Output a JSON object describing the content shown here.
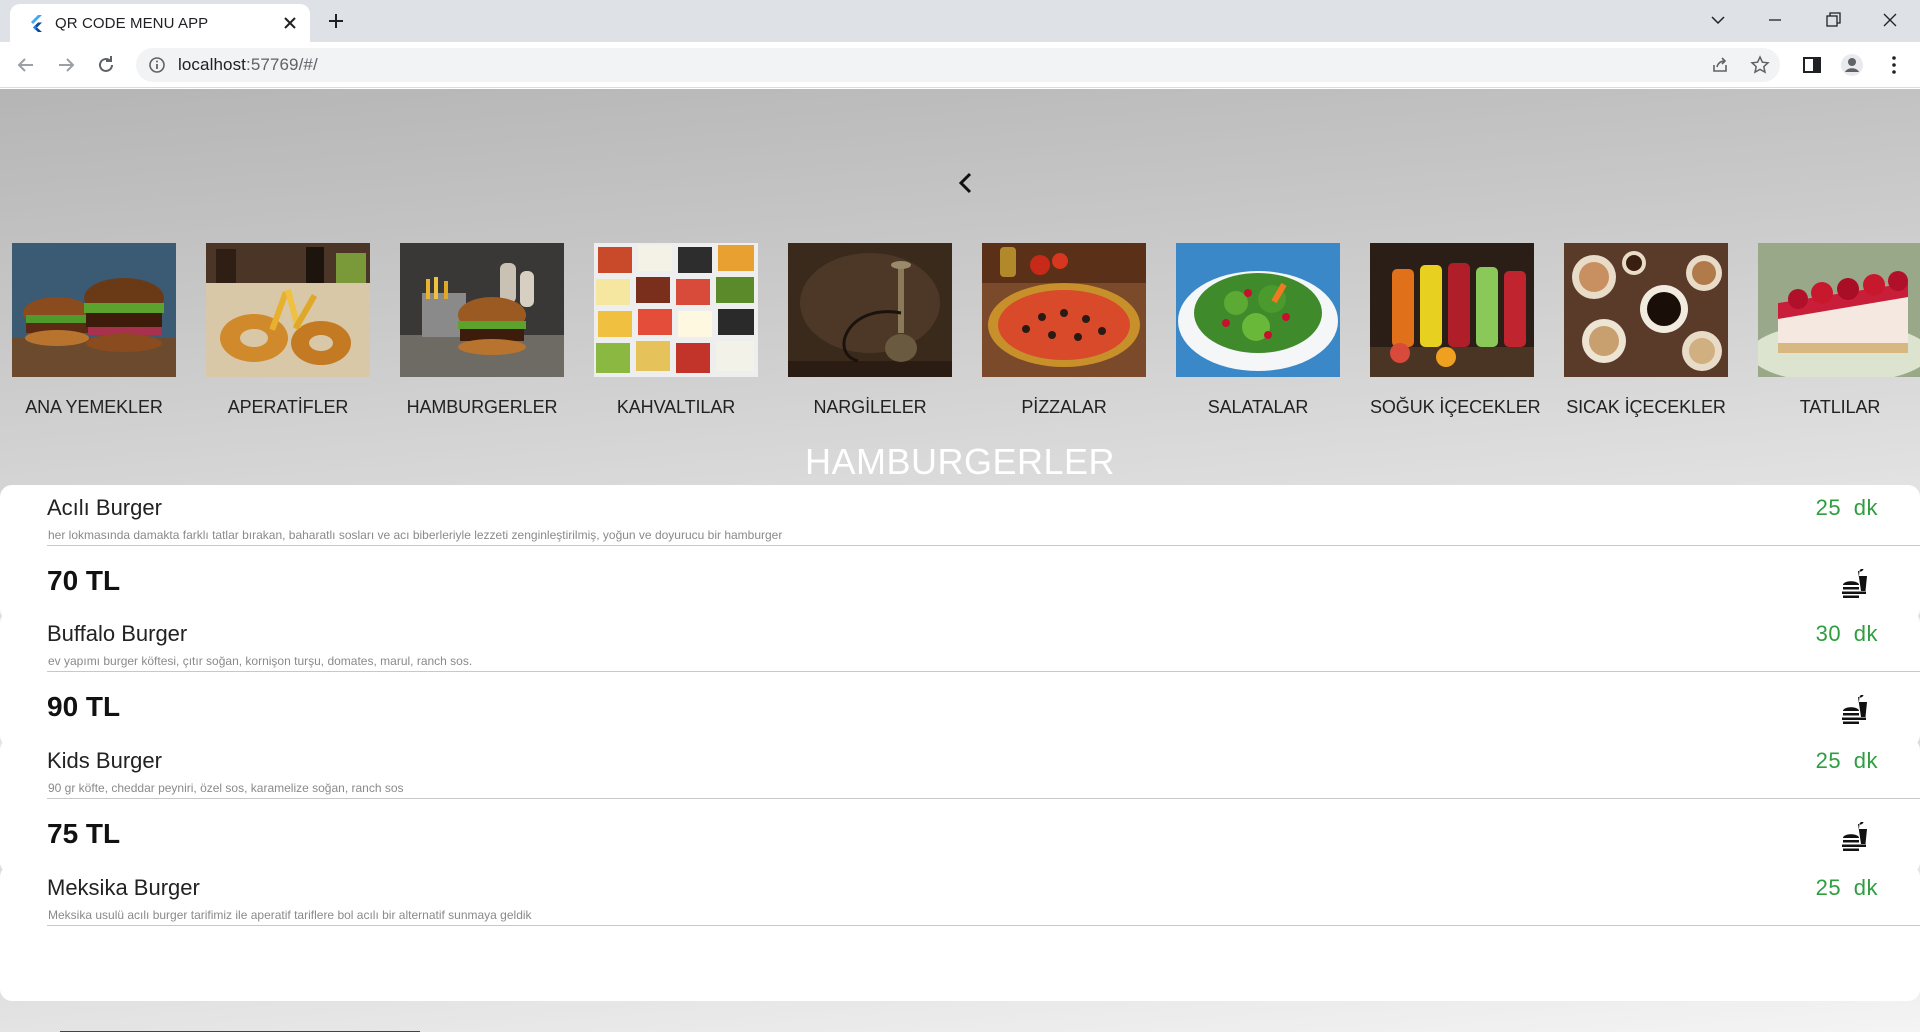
{
  "browser": {
    "tab_title": "QR CODE MENU APP",
    "url_host": "localhost",
    "url_rest": ":57769/#/"
  },
  "colors": {
    "price_time_green": "#2e9e3f",
    "section_title": "#ffffff"
  },
  "categories": [
    {
      "label": "ANA YEMEKLER",
      "icon": "burger-photo"
    },
    {
      "label": "APERATİFLER",
      "icon": "fries-photo"
    },
    {
      "label": "HAMBURGERLER",
      "icon": "hamburger-photo"
    },
    {
      "label": "KAHVALTILAR",
      "icon": "breakfast-photo"
    },
    {
      "label": "NARGİLELER",
      "icon": "hookah-photo"
    },
    {
      "label": "PİZZALAR",
      "icon": "pizza-photo"
    },
    {
      "label": "SALATALAR",
      "icon": "salad-photo"
    },
    {
      "label": "SOĞUK İÇECEKLER",
      "icon": "cold-drinks-photo"
    },
    {
      "label": "SICAK İÇECEKLER",
      "icon": "hot-drinks-photo"
    },
    {
      "label": "TATLILAR",
      "icon": "cake-photo"
    }
  ],
  "section_title": "HAMBURGERLER",
  "items": [
    {
      "name": "Acılı Burger",
      "time": "25 dk",
      "desc": "her lokmasında damakta farklı tatlar bırakan, baharatlı sosları ve acı biberleriyle lezzeti zenginleştirilmiş, yoğun ve doyurucu bir hamburger",
      "price": "70 TL"
    },
    {
      "name": "Buffalo Burger",
      "time": "30 dk",
      "desc": "ev yapımı burger köftesi, çıtır soğan, kornişon turşu, domates, marul, ranch sos.",
      "price": "90 TL"
    },
    {
      "name": "Kids Burger",
      "time": "25 dk",
      "desc": "90 gr köfte, cheddar peyniri, özel sos, karamelize soğan, ranch sos",
      "price": "75 TL"
    },
    {
      "name": "Meksika Burger",
      "time": "25 dk",
      "desc": "Meksika usulü acılı burger tarifimiz ile aperatif tariflere bol acılı bir alternatif sunmaya geldik",
      "price": ""
    }
  ]
}
